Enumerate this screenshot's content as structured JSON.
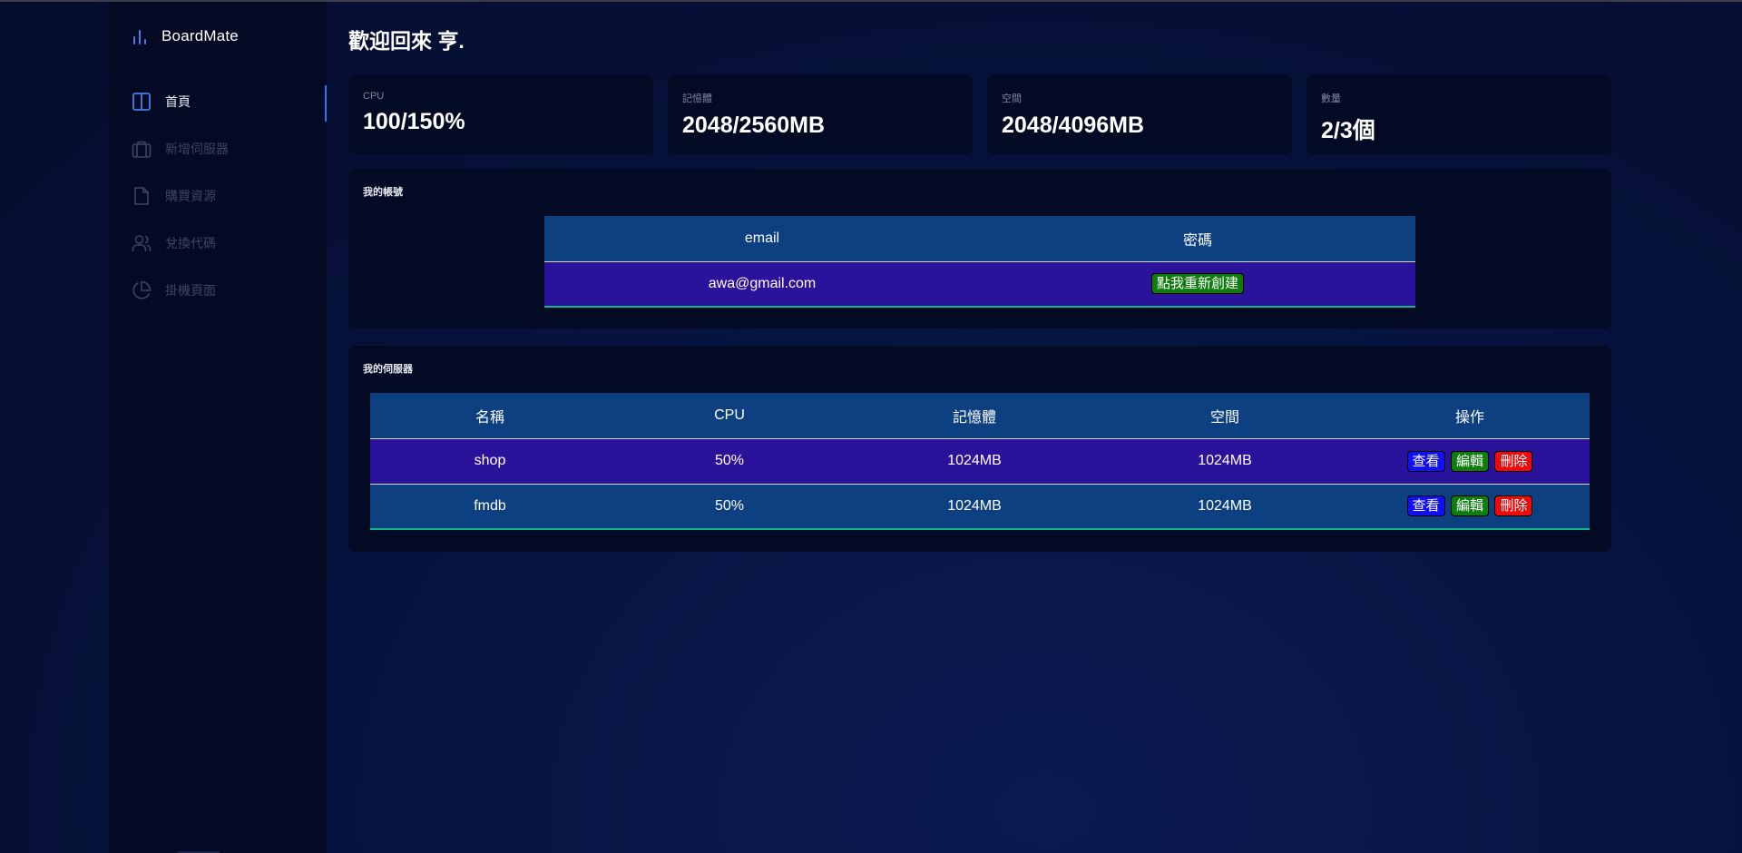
{
  "brand": {
    "name": "BoardMate",
    "accent": "#4a7cf0"
  },
  "sidebar": {
    "items": [
      {
        "label": "首頁",
        "icon": "layout-columns-icon",
        "active": true
      },
      {
        "label": "新增伺服器",
        "icon": "briefcase-icon",
        "active": false
      },
      {
        "label": "購買資源",
        "icon": "document-icon",
        "active": false
      },
      {
        "label": "兌換代碼",
        "icon": "users-icon",
        "active": false
      },
      {
        "label": "掛機頁面",
        "icon": "pie-chart-icon",
        "active": false
      }
    ]
  },
  "main": {
    "welcome": "歡迎回來 亨."
  },
  "stats": [
    {
      "label": "CPU",
      "value": "100/150%"
    },
    {
      "label": "記憶體",
      "value": "2048/2560MB"
    },
    {
      "label": "空間",
      "value": "2048/4096MB"
    },
    {
      "label": "數量",
      "value": "2/3個"
    }
  ],
  "account": {
    "title": "我的帳號",
    "headers": [
      "email",
      "密碼"
    ],
    "email": "awa@gmail.com",
    "reset_button": "點我重新創建"
  },
  "servers": {
    "title": "我的伺服器",
    "headers": [
      "名稱",
      "CPU",
      "記憶體",
      "空間",
      "操作"
    ],
    "rows": [
      {
        "name": "shop",
        "cpu": "50%",
        "memory": "1024MB",
        "disk": "1024MB"
      },
      {
        "name": "fmdb",
        "cpu": "50%",
        "memory": "1024MB",
        "disk": "1024MB"
      }
    ],
    "actions": {
      "view": "查看",
      "edit": "編輯",
      "delete": "刪除"
    }
  },
  "colors": {
    "table_header": "#0d4080",
    "row_purple": "#2a129a",
    "btn_view": "#1010f2",
    "btn_edit": "#0e7d0e",
    "btn_delete": "#ee0a0a",
    "table_bottom_border": "#11b58f"
  }
}
